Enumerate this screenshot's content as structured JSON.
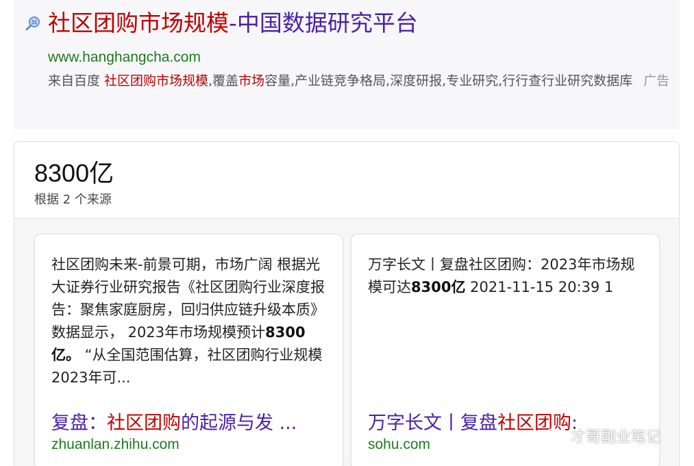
{
  "ad": {
    "icon": "magnifier-icon",
    "title_highlight": "社区团购市场规模",
    "title_rest": "-中国数据研究平台",
    "url": "www.hanghangcha.com",
    "desc_prefix": "来自百度 ",
    "desc_hl1": "社区团购市场规模",
    "desc_mid": ",覆盖",
    "desc_hl2": "市场",
    "desc_rest": "容量,产业链竞争格局,深度研报,专业研究,行行查行业研究数据库",
    "ad_label": "广告"
  },
  "answer": {
    "value": "8300亿",
    "source_count": "根据 2 个来源"
  },
  "sources": [
    {
      "text_a": "社区团购未来-前景可期，市场广阔 根据光大证券行业研究报告《社区团购行业深度报告：聚焦家庭厨房，回归供应链升级本质》数据显示， 2023年市场规模预计",
      "text_bold": "8300亿。",
      "text_b": " “从全国范围估算，社区团购行业规模2023年可...",
      "link_pre": "复盘：",
      "link_hl": "社区团购",
      "link_post": "的起源与发 ...",
      "domain": "zhuanlan.zhihu.com"
    },
    {
      "text_a": "万字长文丨复盘社区团购：2023年市场规模可达",
      "text_bold": "8300亿",
      "text_b": " 2021-11-15 20:39 1",
      "link_pre": "万字长文丨复盘",
      "link_hl": "社区团购",
      "link_post": ":",
      "domain": "sohu.com"
    }
  ],
  "watermark": {
    "icon": "wechat-icon",
    "text": "才哥副业笔记"
  }
}
